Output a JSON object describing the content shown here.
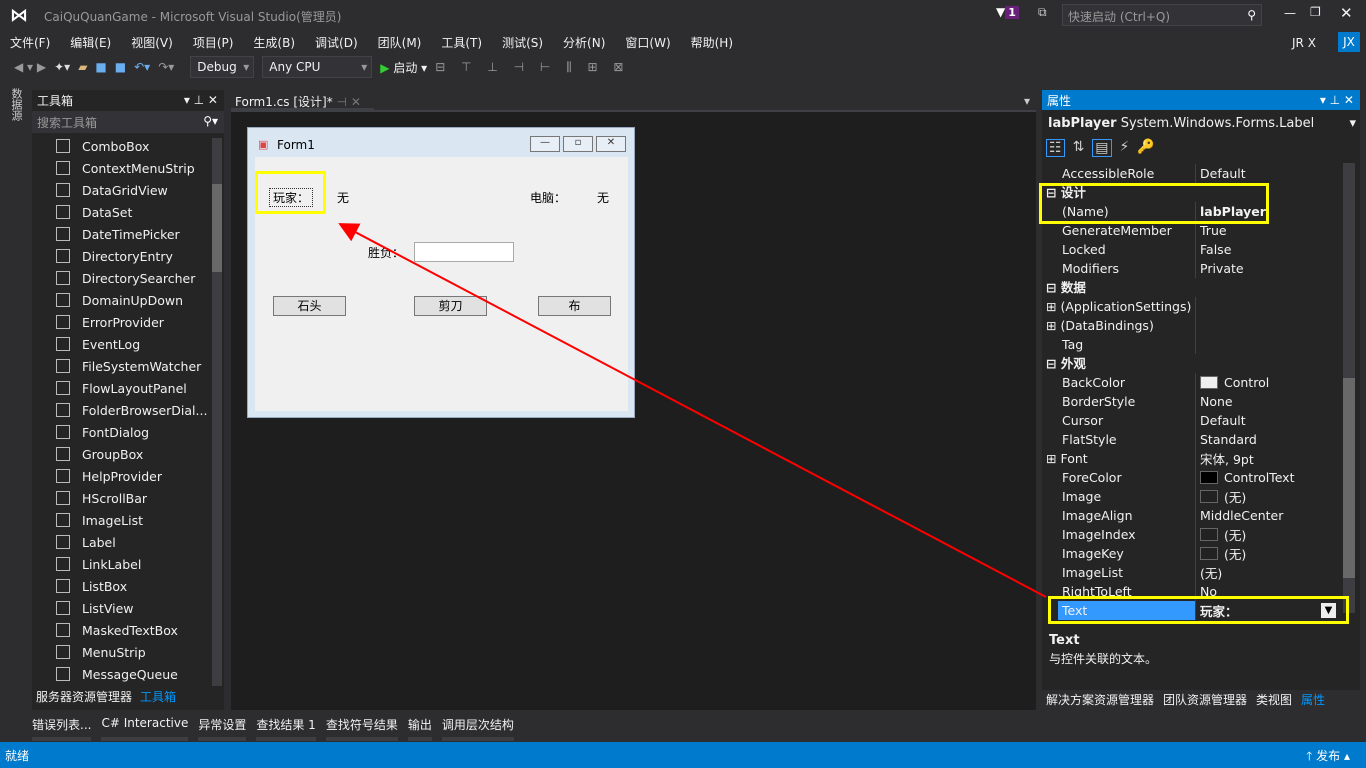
{
  "window": {
    "title": "CaiQuQuanGame - Microsoft Visual Studio(管理员)",
    "notif_count": "1",
    "quick_launch_placeholder": "快速启动 (Ctrl+Q)",
    "user": "JR X",
    "user_initials": "JX"
  },
  "menu": [
    "文件(F)",
    "编辑(E)",
    "视图(V)",
    "项目(P)",
    "生成(B)",
    "调试(D)",
    "团队(M)",
    "工具(T)",
    "测试(S)",
    "分析(N)",
    "窗口(W)",
    "帮助(H)"
  ],
  "toolbar": {
    "config": "Debug",
    "platform": "Any CPU",
    "start": "启动"
  },
  "side_strip": "数据源",
  "toolbox": {
    "title": "工具箱",
    "search_placeholder": "搜索工具箱",
    "items": [
      "ComboBox",
      "ContextMenuStrip",
      "DataGridView",
      "DataSet",
      "DateTimePicker",
      "DirectoryEntry",
      "DirectorySearcher",
      "DomainUpDown",
      "ErrorProvider",
      "EventLog",
      "FileSystemWatcher",
      "FlowLayoutPanel",
      "FolderBrowserDial...",
      "FontDialog",
      "GroupBox",
      "HelpProvider",
      "HScrollBar",
      "ImageList",
      "Label",
      "LinkLabel",
      "ListBox",
      "ListView",
      "MaskedTextBox",
      "MenuStrip",
      "MessageQueue"
    ],
    "tabs": [
      "服务器资源管理器",
      "工具箱"
    ]
  },
  "editor": {
    "tab": "Form1.cs [设计]*"
  },
  "form": {
    "title": "Form1",
    "player_label": "玩家：",
    "player_value": "无",
    "computer_label": "电脑：",
    "computer_value": "无",
    "result_label": "胜负：",
    "result_value": "",
    "buttons": [
      "石头",
      "剪刀",
      "布"
    ]
  },
  "properties": {
    "title": "属性",
    "object_name": "labPlayer",
    "object_type": "System.Windows.Forms.Label",
    "rows": [
      {
        "name": "AccessibleRole",
        "value": "Default"
      },
      {
        "category": "设计"
      },
      {
        "name": "(Name)",
        "value": "labPlayer",
        "bold": true
      },
      {
        "name": "GenerateMember",
        "value": "True"
      },
      {
        "name": "Locked",
        "value": "False"
      },
      {
        "name": "Modifiers",
        "value": "Private"
      },
      {
        "category": "数据"
      },
      {
        "name": "(ApplicationSettings)",
        "value": "",
        "expand": true
      },
      {
        "name": "(DataBindings)",
        "value": "",
        "expand": true
      },
      {
        "name": "Tag",
        "value": ""
      },
      {
        "category": "外观"
      },
      {
        "name": "BackColor",
        "value": "Control",
        "swatch": "#f0f0f0"
      },
      {
        "name": "BorderStyle",
        "value": "None"
      },
      {
        "name": "Cursor",
        "value": "Default"
      },
      {
        "name": "FlatStyle",
        "value": "Standard"
      },
      {
        "name": "Font",
        "value": "宋体, 9pt",
        "expand": true
      },
      {
        "name": "ForeColor",
        "value": "ControlText",
        "swatch": "#000000"
      },
      {
        "name": "Image",
        "value": "(无)",
        "swatch": "#222222"
      },
      {
        "name": "ImageAlign",
        "value": "MiddleCenter"
      },
      {
        "name": "ImageIndex",
        "value": "(无)",
        "swatch": "#222222"
      },
      {
        "name": "ImageKey",
        "value": "(无)",
        "swatch": "#222222"
      },
      {
        "name": "ImageList",
        "value": "(无)"
      },
      {
        "name": "RightToLeft",
        "value": "No"
      },
      {
        "name": "Text",
        "value": "玩家：",
        "selected": true
      }
    ],
    "desc_title": "Text",
    "desc_text": "与控件关联的文本。",
    "tabs": [
      "解决方案资源管理器",
      "团队资源管理器",
      "类视图",
      "属性"
    ]
  },
  "bottom_tabs": [
    "错误列表...",
    "C# Interactive",
    "异常设置",
    "查找结果 1",
    "查找符号结果",
    "输出",
    "调用层次结构"
  ],
  "status": {
    "text": "就绪",
    "publish": "发布"
  },
  "colors": {
    "accent": "#007acc",
    "highlight": "#ffff00",
    "arrow": "#ff0000"
  }
}
